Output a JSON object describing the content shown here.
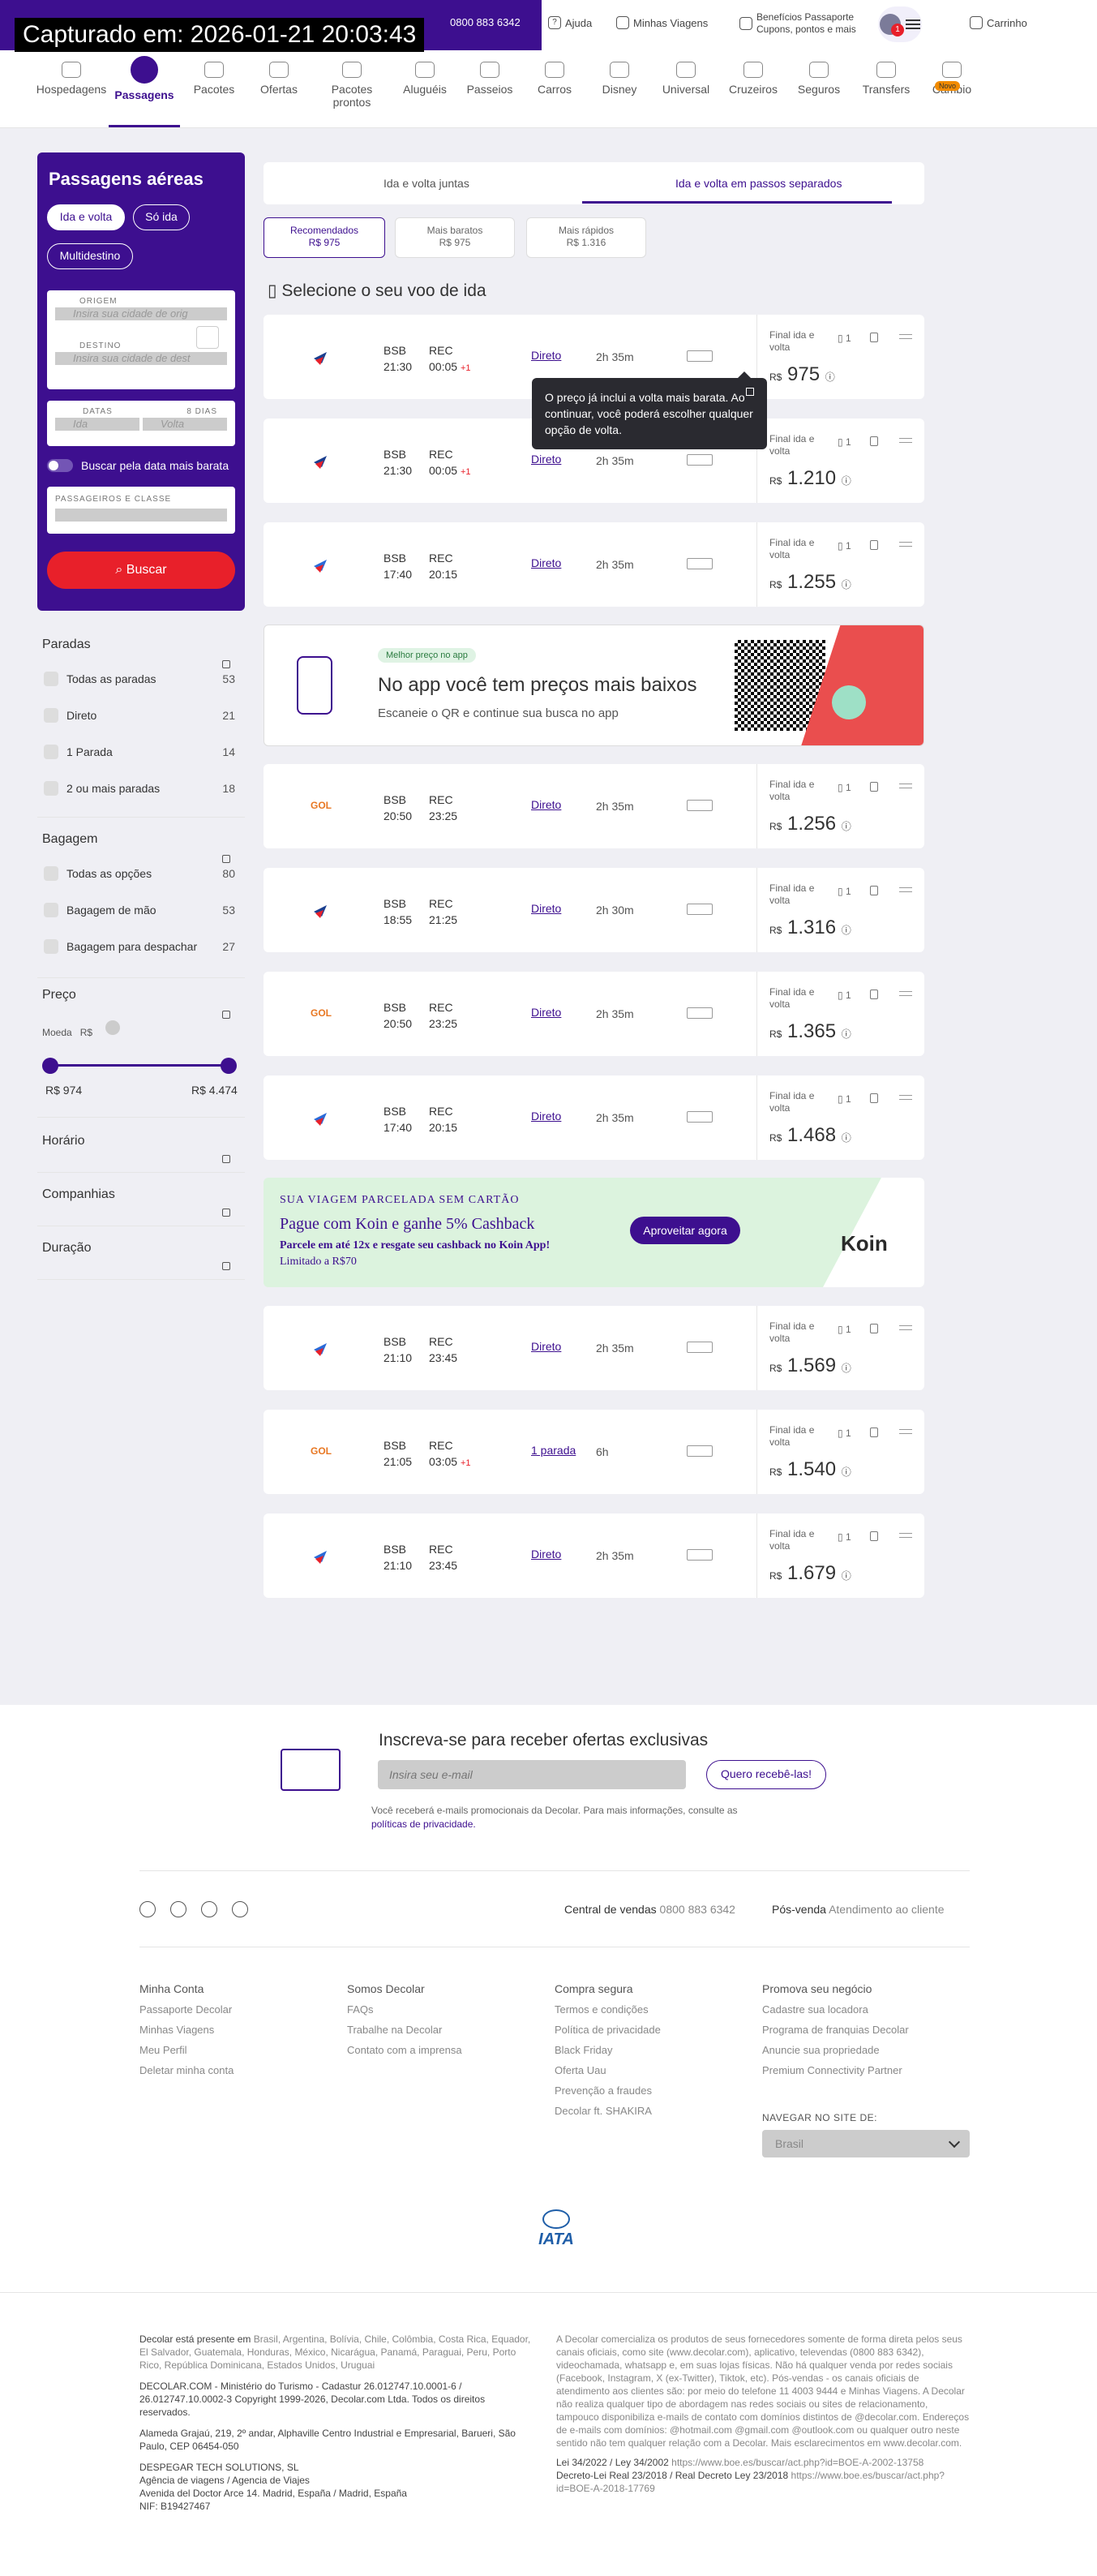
{
  "capture": "Capturado em: 2026-01-21 20:03:43",
  "topbar": {
    "phone": "0800 883 6342",
    "help": "Ajuda",
    "trips": "Minhas Viagens",
    "passport_line1": "Benefícios Passaporte",
    "passport_line2": "Cupons, pontos e mais",
    "notif_count": "1",
    "cart": "Carrinho"
  },
  "nav": [
    {
      "label": "Hospedagens"
    },
    {
      "label": "Passagens"
    },
    {
      "label": "Pacotes"
    },
    {
      "label": "Ofertas"
    },
    {
      "label": "Pacotes prontos"
    },
    {
      "label": "Aluguéis"
    },
    {
      "label": "Passeios"
    },
    {
      "label": "Carros"
    },
    {
      "label": "Disney"
    },
    {
      "label": "Universal"
    },
    {
      "label": "Cruzeiros"
    },
    {
      "label": "Seguros"
    },
    {
      "label": "Transfers"
    },
    {
      "label": "Câmbio"
    }
  ],
  "nav_new_badge": "Novo",
  "search": {
    "title": "Passagens aéreas",
    "trip_types": [
      "Ida e volta",
      "Só ida",
      "Multidestino"
    ],
    "origin_label": "ORIGEM",
    "origin_placeholder": "Insira sua cidade de orig",
    "dest_label": "DESTINO",
    "dest_placeholder": "Insira sua cidade de dest",
    "dates_label": "DATAS",
    "days_label": "8 DIAS",
    "ida_placeholder": "Ida",
    "volta_placeholder": "Volta",
    "flex_label": "Buscar pela data mais barata",
    "pax_label": "PASSAGEIROS E CLASSE",
    "button": "Buscar"
  },
  "filters": {
    "stops": {
      "title": "Paradas",
      "options": [
        {
          "label": "Todas as paradas",
          "count": "53"
        },
        {
          "label": "Direto",
          "count": "21"
        },
        {
          "label": "1 Parada",
          "count": "14"
        },
        {
          "label": "2 ou mais paradas",
          "count": "18"
        }
      ]
    },
    "baggage": {
      "title": "Bagagem",
      "options": [
        {
          "label": "Todas as opções",
          "count": "80"
        },
        {
          "label": "Bagagem de mão",
          "count": "53"
        },
        {
          "label": "Bagagem para despachar",
          "count": "27"
        }
      ]
    },
    "price": {
      "title": "Preço",
      "currency_label": "Moeda",
      "currency": "R$",
      "min": "R$ 974",
      "max": "R$ 4.474"
    },
    "schedule": "Horário",
    "airlines": "Companhias",
    "duration": "Duração"
  },
  "trip_tabs": [
    "Ida e volta juntas",
    "Ida e volta em passos separados"
  ],
  "sort": [
    {
      "label": "Recomendados",
      "price": "R$ 975"
    },
    {
      "label": "Mais baratos",
      "price": "R$ 975"
    },
    {
      "label": "Mais rápidos",
      "price": "R$ 1.316"
    }
  ],
  "section_title": "Selecione o seu voo de ida",
  "price_label": "Final ida e volta",
  "currency": "R$",
  "pax_count": "1",
  "flights": [
    {
      "airline": "LATAM",
      "from": "BSB",
      "to": "REC",
      "dep": "21:30",
      "arr": "00:05",
      "plus": "+1",
      "stops": "Direto",
      "duration": "2h 35m",
      "price": "975"
    },
    {
      "airline": "LATAM",
      "from": "BSB",
      "to": "REC",
      "dep": "21:30",
      "arr": "00:05",
      "plus": "+1",
      "stops": "Direto",
      "duration": "2h 35m",
      "price": "1.210"
    },
    {
      "airline": "Azul",
      "from": "BSB",
      "to": "REC",
      "dep": "17:40",
      "arr": "20:15",
      "plus": "",
      "stops": "Direto",
      "duration": "2h 35m",
      "price": "1.255"
    },
    {
      "airline": "GOL",
      "from": "BSB",
      "to": "REC",
      "dep": "20:50",
      "arr": "23:25",
      "plus": "",
      "stops": "Direto",
      "duration": "2h 35m",
      "price": "1.256"
    },
    {
      "airline": "LATAM",
      "from": "BSB",
      "to": "REC",
      "dep": "18:55",
      "arr": "21:25",
      "plus": "",
      "stops": "Direto",
      "duration": "2h 30m",
      "price": "1.316"
    },
    {
      "airline": "GOL",
      "from": "BSB",
      "to": "REC",
      "dep": "20:50",
      "arr": "23:25",
      "plus": "",
      "stops": "Direto",
      "duration": "2h 35m",
      "price": "1.365"
    },
    {
      "airline": "Azul",
      "from": "BSB",
      "to": "REC",
      "dep": "17:40",
      "arr": "20:15",
      "plus": "",
      "stops": "Direto",
      "duration": "2h 35m",
      "price": "1.468"
    },
    {
      "airline": "Azul",
      "from": "BSB",
      "to": "REC",
      "dep": "21:10",
      "arr": "23:45",
      "plus": "",
      "stops": "Direto",
      "duration": "2h 35m",
      "price": "1.569"
    },
    {
      "airline": "GOL",
      "from": "BSB",
      "to": "REC",
      "dep": "21:05",
      "arr": "03:05",
      "plus": "+1",
      "stops": "1 parada",
      "duration": "6h",
      "price": "1.540"
    },
    {
      "airline": "Azul",
      "from": "BSB",
      "to": "REC",
      "dep": "21:10",
      "arr": "23:45",
      "plus": "",
      "stops": "Direto",
      "duration": "2h 35m",
      "price": "1.679"
    }
  ],
  "tooltip": "O preço já inclui a volta mais barata. Ao continuar, você poderá escolher qualquer opção de volta.",
  "app_banner": {
    "tag": "Melhor preço no app",
    "headline": "No app você tem preços mais baixos",
    "sub": "Escaneie o QR e continue sua busca no app"
  },
  "koin_banner": {
    "kicker": "SUA VIAGEM PARCELADA SEM CARTÃO",
    "headline": "Pague com Koin e ganhe 5% Cashback",
    "line2": "Parcele em até 12x e resgate seu cashback no Koin App!",
    "line3": "Limitado a R$70",
    "cta": "Aproveitar agora",
    "logo": "Koin"
  },
  "newsletter": {
    "title": "Inscreva-se para receber ofertas exclusivas",
    "placeholder": "Insira seu e-mail",
    "button": "Quero recebê-las!",
    "note": "Você receberá e-mails promocionais da Decolar. Para mais informações, consulte as",
    "note_link": "políticas de privacidade."
  },
  "footer": {
    "sales_label": "Central de vendas",
    "sales_phone": "0800 883 6342",
    "post_label": "Pós-venda",
    "post_value": "Atendimento ao cliente",
    "columns": [
      {
        "title": "Minha Conta",
        "links": [
          "Passaporte Decolar",
          "Minhas Viagens",
          "Meu Perfil",
          "Deletar minha conta"
        ]
      },
      {
        "title": "Somos Decolar",
        "links": [
          "FAQs",
          "Trabalhe na Decolar",
          "Contato com a imprensa"
        ]
      },
      {
        "title": "Compra segura",
        "links": [
          "Termos e condições",
          "Política de privacidade",
          "Black Friday",
          "Oferta Uau",
          "Prevenção a fraudes",
          "Decolar ft. SHAKIRA"
        ]
      },
      {
        "title": "Promova seu negócio",
        "links": [
          "Cadastre sua locadora",
          "Programa de franquias Decolar",
          "Anuncie sua propriedade",
          "Premium Connectivity Partner"
        ]
      }
    ],
    "site_label": "NAVEGAR NO SITE DE:",
    "site_value": "Brasil",
    "iata": "IATA"
  },
  "legal": {
    "presence_prefix": "Decolar está presente em",
    "presence_countries": "Brasil, Argentina, Bolívia, Chile, Colômbia, Costa Rica, Equador, El Salvador, Guatemala, Honduras, México, Nicarágua, Panamá, Paraguai, Peru, Porto Rico, República Dominicana, Estados Unidos, Uruguai",
    "company": "DECOLAR.COM - Ministério do Turismo - Cadastur 26.012747.10.0001-6 / 26.012747.10.0002-3 Copyright 1999-2026, Decolar.com Ltda. Todos os direitos reservados.",
    "address": "Alameda Grajaú, 219, 2º andar, Alphaville Centro Industrial e Empresarial, Barueri, São Paulo, CEP 06454-050",
    "despegar1": "DESPEGAR TECH SOLUTIONS, SL",
    "despegar2": "Agência de viagens / Agencia de Viajes",
    "despegar3": "Avenida del Doctor Arce 14. Madrid, España / Madrid, España",
    "despegar4": "NIF: B19427467",
    "right_text": "A Decolar comercializa os produtos de seus fornecedores somente de forma direta pelos seus canais oficiais, como site (www.decolar.com), aplicativo, televendas (0800 883 6342), videochamada, whatsapp e, em suas lojas físicas. Não há qualquer venda por redes sociais (Facebook, Instagram, X (ex-Twitter), Tiktok, etc). Pós-vendas - os canais oficiais de atendimento aos clientes são: por meio do telefone 11 4003 9444 e Minhas Viagens. A Decolar não realiza qualquer tipo de abordagem nas redes sociais ou sites de relacionamento, tampouco disponibiliza e-mails de contato com domínios distintos de @decolar.com. Endereços de e-mails com domínios: @hotmail.com @gmail.com @outlook.com ou qualquer outro neste sentido não tem qualquer relação com a Decolar. Mais esclarecimentos em www.decolar.com.",
    "law1": "Lei 34/2022 / Ley 34/2002",
    "law1_link": "https://www.boe.es/buscar/act.php?id=BOE-A-2002-13758",
    "law2": "Decreto-Lei Real 23/2018 / Real Decreto Ley 23/2018",
    "law2_link": "https://www.boe.es/buscar/act.php?id=BOE-A-2018-17769"
  }
}
